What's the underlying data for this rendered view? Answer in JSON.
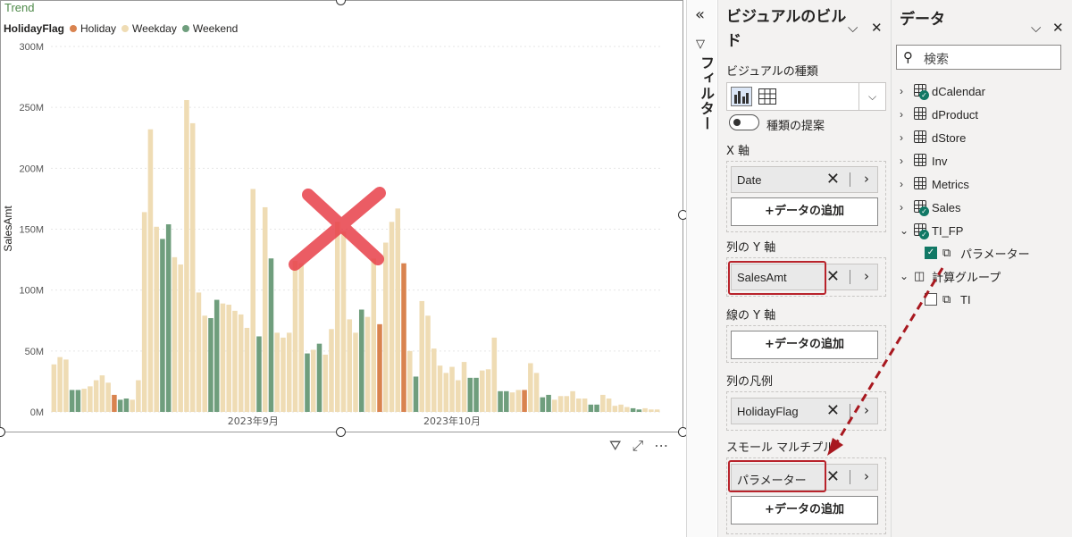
{
  "visual": {
    "title": "Trend",
    "legend_title": "HolidayFlag",
    "legend": [
      {
        "label": "Holiday",
        "color": "#d9834f"
      },
      {
        "label": "Weekday",
        "color": "#efdcb4"
      },
      {
        "label": "Weekend",
        "color": "#6f9e7d"
      }
    ],
    "toolbar": {
      "filter_icon": "filter-icon",
      "focus_icon": "focus-mode-icon",
      "more_icon": "more-options-icon"
    }
  },
  "chart_data": {
    "type": "bar",
    "ylabel": "SalesAmt",
    "ylim": [
      0,
      300
    ],
    "y_unit": "M",
    "y_ticks": [
      "300M",
      "250M",
      "200M",
      "150M",
      "100M",
      "50M",
      "0M"
    ],
    "x_tick_labels": [
      {
        "label": "2023年9月",
        "index": 33
      },
      {
        "label": "2023年10月",
        "index": 66
      }
    ],
    "series": [
      {
        "name": "Holiday",
        "color": "#d9834f",
        "points": [
          [
            10,
            14
          ],
          [
            54,
            72
          ],
          [
            58,
            122
          ],
          [
            78,
            18
          ]
        ]
      },
      {
        "name": "Weekend",
        "color": "#6f9e7d",
        "points": [
          [
            3,
            18
          ],
          [
            4,
            18
          ],
          [
            11,
            10
          ],
          [
            12,
            11
          ],
          [
            18,
            142
          ],
          [
            19,
            154
          ],
          [
            26,
            77
          ],
          [
            27,
            92
          ],
          [
            34,
            62
          ],
          [
            36,
            126
          ],
          [
            42,
            48
          ],
          [
            44,
            56
          ],
          [
            51,
            84
          ],
          [
            60,
            29
          ],
          [
            69,
            28
          ],
          [
            70,
            28
          ],
          [
            74,
            17
          ],
          [
            75,
            17
          ],
          [
            81,
            12
          ],
          [
            82,
            14
          ],
          [
            89,
            6
          ],
          [
            90,
            6
          ],
          [
            96,
            3
          ],
          [
            97,
            2
          ]
        ]
      },
      {
        "name": "Weekday",
        "color": "#efdcb4",
        "points": [
          [
            0,
            39
          ],
          [
            1,
            45
          ],
          [
            2,
            43
          ],
          [
            5,
            19
          ],
          [
            6,
            21
          ],
          [
            7,
            26
          ],
          [
            8,
            30
          ],
          [
            9,
            24
          ],
          [
            13,
            10
          ],
          [
            14,
            26
          ],
          [
            15,
            164
          ],
          [
            16,
            232
          ],
          [
            17,
            152
          ],
          [
            20,
            127
          ],
          [
            21,
            121
          ],
          [
            22,
            256
          ],
          [
            23,
            237
          ],
          [
            24,
            98
          ],
          [
            25,
            79
          ],
          [
            28,
            89
          ],
          [
            29,
            88
          ],
          [
            30,
            83
          ],
          [
            31,
            80
          ],
          [
            32,
            69
          ],
          [
            33,
            183
          ],
          [
            35,
            168
          ],
          [
            37,
            65
          ],
          [
            38,
            61
          ],
          [
            39,
            65
          ],
          [
            40,
            124
          ],
          [
            41,
            122
          ],
          [
            43,
            51
          ],
          [
            45,
            47
          ],
          [
            46,
            68
          ],
          [
            47,
            156
          ],
          [
            48,
            148
          ],
          [
            49,
            76
          ],
          [
            50,
            65
          ],
          [
            52,
            78
          ],
          [
            53,
            126
          ],
          [
            55,
            139
          ],
          [
            56,
            156
          ],
          [
            57,
            167
          ],
          [
            59,
            50
          ],
          [
            61,
            91
          ],
          [
            62,
            79
          ],
          [
            63,
            52
          ],
          [
            64,
            38
          ],
          [
            65,
            32
          ],
          [
            66,
            37
          ],
          [
            67,
            26
          ],
          [
            68,
            41
          ],
          [
            71,
            34
          ],
          [
            72,
            35
          ],
          [
            73,
            61
          ],
          [
            76,
            16
          ],
          [
            77,
            18
          ],
          [
            79,
            40
          ],
          [
            80,
            32
          ],
          [
            83,
            10
          ],
          [
            84,
            13
          ],
          [
            85,
            13
          ],
          [
            86,
            17
          ],
          [
            87,
            11
          ],
          [
            88,
            11
          ],
          [
            91,
            14
          ],
          [
            92,
            11
          ],
          [
            93,
            5
          ],
          [
            94,
            6
          ],
          [
            95,
            4
          ],
          [
            98,
            3
          ],
          [
            99,
            2
          ],
          [
            100,
            2
          ]
        ]
      }
    ]
  },
  "filter_strip": {
    "collapse_icon": "double-chevron-left-icon",
    "label": "フィルター"
  },
  "build_pane": {
    "title": "ビジュアルのビルド",
    "viz_type_label": "ビジュアルの種類",
    "toggle_label": "種類の提案",
    "x_axis": {
      "label": "X 軸",
      "field": "Date",
      "add": "+データの追加"
    },
    "y_col": {
      "label": "列の Y 軸",
      "field": "SalesAmt"
    },
    "y_line": {
      "label": "線の Y 軸",
      "add": "+データの追加"
    },
    "legend_well": {
      "label": "列の凡例",
      "field": "HolidayFlag"
    },
    "small_multiples": {
      "label": "スモール マルチプル",
      "field": "パラメーター",
      "add": "+データの追加"
    }
  },
  "data_pane": {
    "title": "データ",
    "search_placeholder": "検索",
    "tables": [
      {
        "name": "dCalendar",
        "chev": "›",
        "badge": true
      },
      {
        "name": "dProduct",
        "chev": "›",
        "badge": false
      },
      {
        "name": "dStore",
        "chev": "›",
        "badge": false
      },
      {
        "name": "Inv",
        "chev": "›",
        "badge": false
      },
      {
        "name": "Metrics",
        "chev": "›",
        "badge": false
      },
      {
        "name": "Sales",
        "chev": "›",
        "badge": true
      },
      {
        "name": "TI_FP",
        "chev": "⌄",
        "badge": true
      }
    ],
    "ti_fp_child": "パラメーター",
    "calc_group": "計算グループ",
    "calc_child": "TI"
  }
}
